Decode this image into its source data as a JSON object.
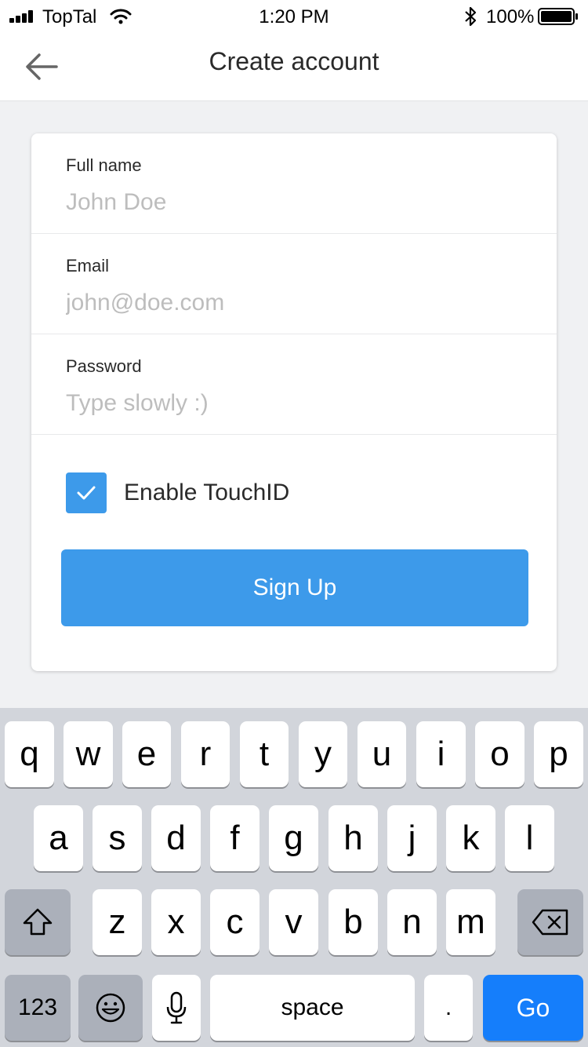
{
  "status_bar": {
    "carrier": "TopTal",
    "time": "1:20 PM",
    "battery_percent": "100%"
  },
  "nav": {
    "title": "Create account",
    "back_icon": "arrow-left-icon"
  },
  "form": {
    "fields": [
      {
        "label": "Full name",
        "placeholder": "John Doe",
        "value": ""
      },
      {
        "label": "Email",
        "placeholder": "john@doe.com",
        "value": ""
      },
      {
        "label": "Password",
        "placeholder": "Type slowly :)",
        "value": ""
      }
    ],
    "touchid": {
      "label": "Enable TouchID",
      "checked": true
    },
    "submit_label": "Sign Up"
  },
  "colors": {
    "accent": "#3d9aea",
    "go_key": "#157efb",
    "keyboard_bg": "#d2d5db",
    "page_bg": "#f0f1f3"
  },
  "keyboard": {
    "row1": [
      "q",
      "w",
      "e",
      "r",
      "t",
      "y",
      "u",
      "i",
      "o",
      "p"
    ],
    "row2": [
      "a",
      "s",
      "d",
      "f",
      "g",
      "h",
      "j",
      "k",
      "l"
    ],
    "row3": [
      "z",
      "x",
      "c",
      "v",
      "b",
      "n",
      "m"
    ],
    "numbers_label": "123",
    "space_label": "space",
    "period_label": ".",
    "go_label": "Go",
    "icons": {
      "shift": "shift-icon",
      "delete": "backspace-icon",
      "emoji": "emoji-icon",
      "mic": "microphone-icon"
    }
  }
}
